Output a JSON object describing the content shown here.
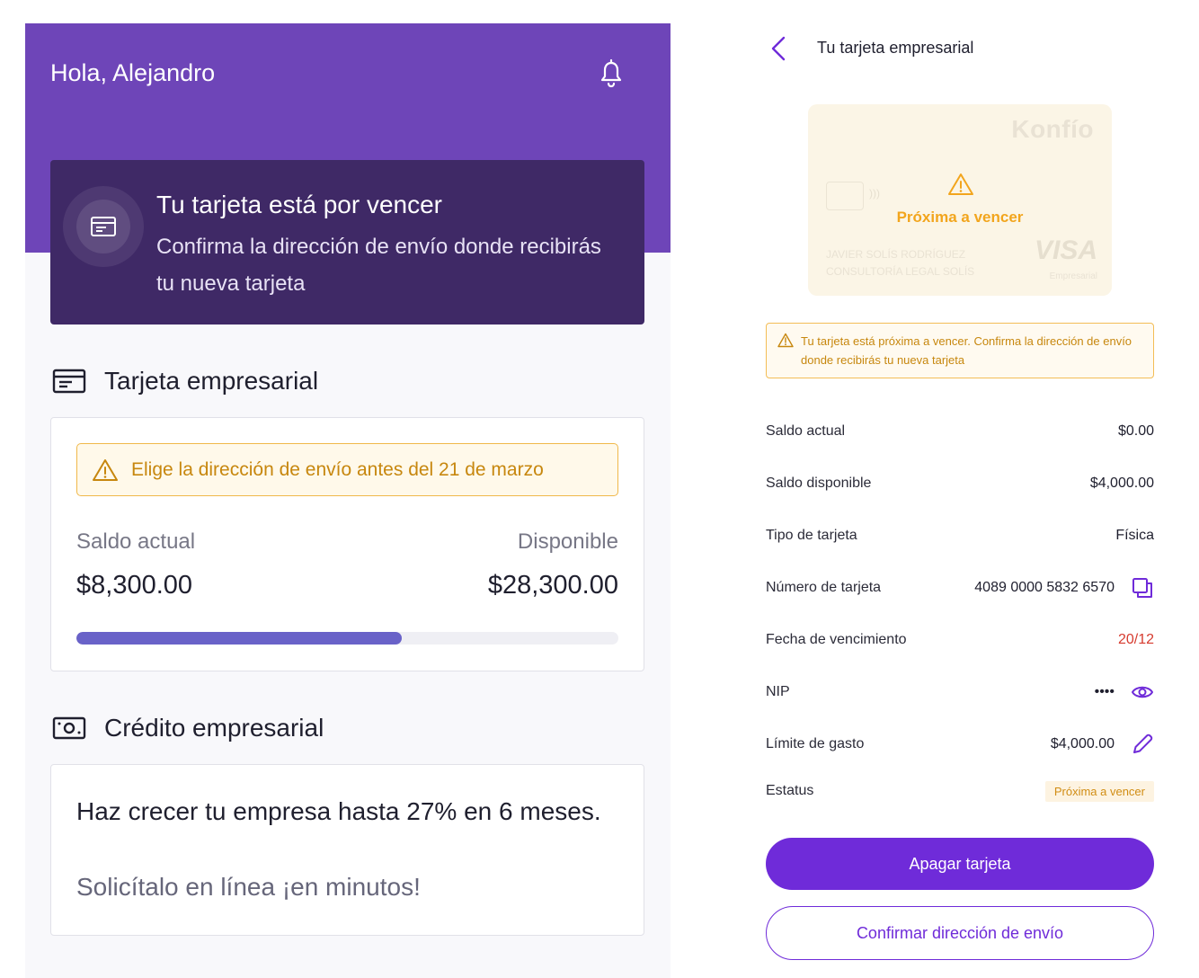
{
  "home": {
    "greeting": "Hola, Alejandro",
    "promo": {
      "title": "Tu tarjeta está por vencer",
      "text": "Confirma la dirección de envío donde recibirás tu nueva tarjeta"
    },
    "card_section": {
      "title": "Tarjeta empresarial",
      "warning": "Elige la dirección de envío antes del 21 de marzo",
      "current_label": "Saldo actual",
      "current_value": "$8,300.00",
      "available_label": "Disponible",
      "available_value": "$28,300.00",
      "progress_fraction": 0.6
    },
    "credit_section": {
      "title": "Crédito empresarial",
      "headline": "Haz crecer tu empresa hasta 27% en 6 meses.",
      "subtext": "Solicítalo en línea ¡en minutos!"
    }
  },
  "detail": {
    "title": "Tu tarjeta empresarial",
    "card": {
      "brand": "Konfío",
      "state": "Próxima a vencer",
      "holder_name": "JAVIER SOLÍS RODRÍGUEZ",
      "company": "CONSULTORÍA LEGAL SOLÍS",
      "network": "VISA",
      "network_sub": "Empresarial",
      "nfc": ")))"
    },
    "warning": "Tu tarjeta está próxima a vencer. Confirma la dirección de envío donde recibirás tu nueva tarjeta",
    "rows": [
      {
        "label": "Saldo actual",
        "value": "$0.00"
      },
      {
        "label": "Saldo disponible",
        "value": "$4,000.00"
      },
      {
        "label": "Tipo de tarjeta",
        "value": "Física"
      },
      {
        "label": "Número de tarjeta",
        "value": "4089 0000 5832 6570"
      },
      {
        "label": "Fecha de vencimiento",
        "value": "20/12"
      },
      {
        "label": "NIP",
        "value": "••••"
      },
      {
        "label": "Límite de gasto",
        "value": "$4,000.00"
      },
      {
        "label": "Estatus",
        "value": "Próxima a vencer"
      }
    ],
    "primary_button": "Apagar tarjeta",
    "secondary_button": "Confirmar dirección de envío"
  },
  "colors": {
    "header_purple": "#6e45b8",
    "promo_dark": "#3f2966",
    "accent": "#6f2bd9",
    "progress": "#6962c8",
    "warning": "#f0b84a",
    "expiry_red": "#d63b2f"
  },
  "icons": [
    "bell-icon",
    "card-icon",
    "money-icon",
    "warning-icon",
    "chevron-left-icon",
    "copy-icon",
    "eye-icon",
    "pencil-icon"
  ]
}
